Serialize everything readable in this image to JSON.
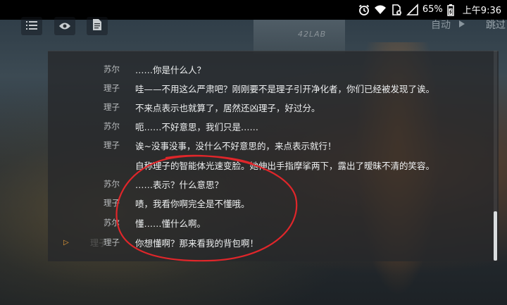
{
  "status_bar": {
    "battery": "65%",
    "time": "上午9:36"
  },
  "toolbar": {
    "menu_icon": "list-icon",
    "view_icon": "eye-icon",
    "log_icon": "document-icon",
    "auto_label": "自动",
    "skip_label": "跳过"
  },
  "background": {
    "lab_text": "42LAB"
  },
  "dialogue_log": [
    {
      "speaker": "苏尔",
      "text": "……你是什么人？"
    },
    {
      "speaker": "理子",
      "text": "哇——不用这么严肃吧？刚刚要不是理子引开净化者，你们已经被发现了诶。"
    },
    {
      "speaker": "理子",
      "text": "不来点表示也就算了，居然还凶理子，好过分。"
    },
    {
      "speaker": "苏尔",
      "text": "呃……不好意思，我们只是……"
    },
    {
      "speaker": "理子",
      "text": "诶~没事没事，没什么不好意思的，来点表示就行！"
    },
    {
      "speaker": "",
      "text": "自称理子的智能体光速变脸。她伸出手指摩挲两下，露出了暧昧不清的笑容。"
    },
    {
      "speaker": "苏尔",
      "text": "……表示？什么意思？"
    },
    {
      "speaker": "理子",
      "text": "啧，我看你啊完全是不懂哦。"
    },
    {
      "speaker": "苏尔",
      "text": "懂……懂什么啊。"
    },
    {
      "speaker": "理子",
      "text": "你想懂啊？那来看我的背包啊！"
    }
  ],
  "current_line_ghost": "理子",
  "colors": {
    "annotation_red": "#e0262a",
    "current_marker": "#f0a23a"
  }
}
